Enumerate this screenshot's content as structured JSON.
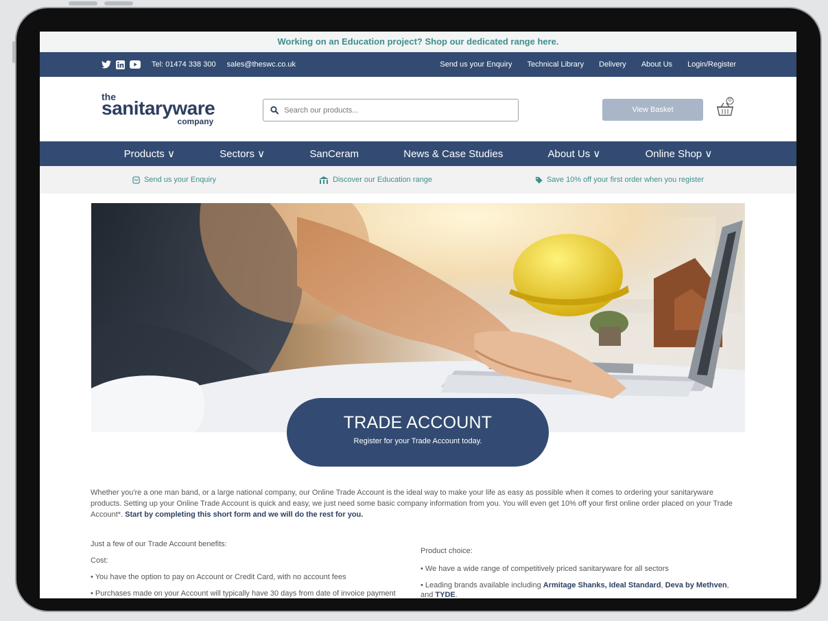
{
  "promo": {
    "text": "Working on an Education project? Shop our dedicated range here."
  },
  "topbar": {
    "phone": "Tel: 01474 338 300",
    "email": "sales@theswc.co.uk",
    "links": [
      "Send us your Enquiry",
      "Technical Library",
      "Delivery",
      "About Us",
      "Login/Register"
    ]
  },
  "logo": {
    "the": "the",
    "main": "sanitaryware",
    "company": "company"
  },
  "search": {
    "placeholder": "Search our products..."
  },
  "basket": {
    "label": "View Basket",
    "count": "0"
  },
  "nav": [
    "Products ∨",
    "Sectors ∨",
    "SanCeram",
    "News & Case Studies",
    "About Us ∨",
    "Online Shop ∨"
  ],
  "usp": [
    "Send us your Enquiry",
    "Discover our Education range",
    "Save 10% off your first order when you register"
  ],
  "hero": {
    "title": "TRADE ACCOUNT",
    "subtitle": "Register for your Trade Account today."
  },
  "intro": {
    "text": "Whether you're a one man band, or a large national company, our Online Trade Account is the ideal way to make your life as easy as possible when it comes to ordering your sanitaryware products. Setting up your Online Trade Account is quick and easy, we just need some basic company information from you. You will even get 10% off your first online order placed on your Trade Account*.",
    "cta": "Start by completing this short form and we will do the rest for you."
  },
  "benefits": {
    "heading": "Just a few of our Trade Account benefits:",
    "cost_heading": "Cost:",
    "cost_items": [
      "• You have the option to pay on Account or Credit Card, with no account fees",
      "• Purchases made on your Account will typically have 30 days from date of invoice payment"
    ],
    "product_heading": "Product choice:",
    "product_item1": "• We have a wide range of competitively priced sanitaryware for all sectors",
    "product_item2_pre": "• Leading brands available including ",
    "product_item2_bold": "Armitage Shanks, Ideal Standard",
    "product_item2_sep": ", ",
    "product_item2_bold2": "Deva by Methven",
    "product_item2_and": ", and",
    "product_item2_bold3": "TYDE",
    "product_item2_end": "."
  },
  "colors": {
    "navy": "#334b72",
    "teal": "#3e8e8c",
    "basket": "#a9b6c8"
  }
}
